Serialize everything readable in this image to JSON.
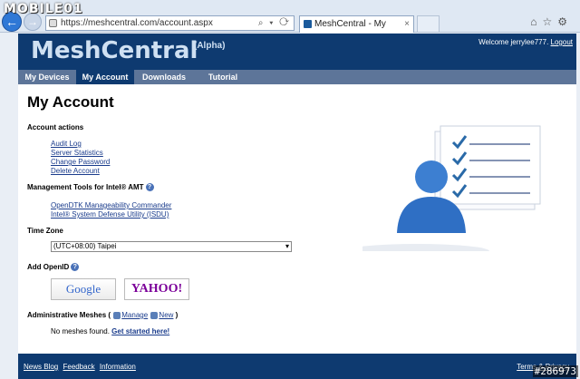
{
  "watermark": "MOBILE01",
  "browser": {
    "address": "https://meshcentral.com/account.aspx",
    "tab_title": "MeshCentral - My Account",
    "tab_close": "×"
  },
  "header": {
    "logo": "MeshCentral",
    "logo_suffix": "(Alpha)",
    "welcome_text": "Welcome jerrylee777.",
    "logout_label": "Logout"
  },
  "nav": {
    "items": [
      {
        "label": "My Devices"
      },
      {
        "label": "My Account"
      },
      {
        "label": "Downloads"
      },
      {
        "label": "Tutorial"
      }
    ]
  },
  "main": {
    "title": "My Account",
    "account_actions": {
      "heading": "Account actions",
      "links": [
        "Audit Log",
        "Server Statistics",
        "Change Password",
        "Delete Account"
      ]
    },
    "amt_tools": {
      "heading": "Management Tools for Intel® AMT",
      "links": [
        "OpenDTK Manageability Commander",
        "Intel® System Defense Utility (ISDU)"
      ]
    },
    "time_zone": {
      "heading": "Time Zone",
      "selected": "(UTC+08:00) Taipei"
    },
    "openid": {
      "heading": "Add OpenID",
      "google_label": "Google",
      "yahoo_label": "YAHOO!"
    },
    "admin_meshes": {
      "heading": "Administrative Meshes (",
      "manage_label": "Manage",
      "new_label": "New",
      "close_paren": ")",
      "empty_text": "No meshes found.",
      "get_started_label": "Get started here!"
    }
  },
  "footer": {
    "links": [
      "News Blog",
      "Feedback",
      "Information"
    ],
    "terms": "Terms & Privacy"
  },
  "image_code": "#286973",
  "colors": {
    "header_bg": "#0e3a70",
    "nav_bg": "#5d7599",
    "link": "#1a3c8c"
  }
}
